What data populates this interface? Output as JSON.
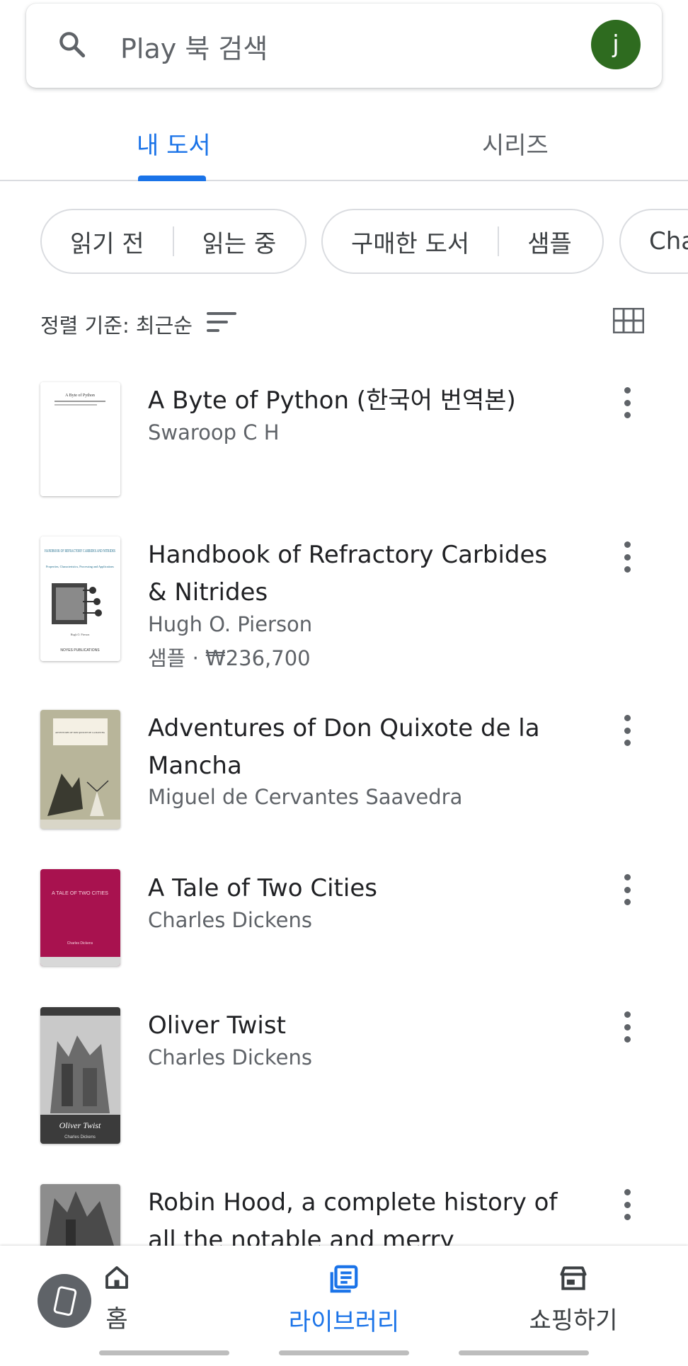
{
  "search": {
    "placeholder": "Play 북 검색",
    "avatar_letter": "j"
  },
  "tabs": [
    {
      "label": "내 도서",
      "active": true
    },
    {
      "label": "시리즈",
      "active": false
    }
  ],
  "filters": {
    "chip1": [
      "읽기 전",
      "읽는 중"
    ],
    "chip2": [
      "구매한 도서",
      "샘플"
    ],
    "chip3": [
      "Cha"
    ]
  },
  "sort": {
    "label": "정렬 기준: 최근순"
  },
  "books": [
    {
      "title": "A Byte of Python (한국어 번역본)",
      "author": "Swaroop C H",
      "meta": ""
    },
    {
      "title": "Handbook of Refractory Carbides & Nitrides",
      "author": "Hugh O. Pierson",
      "meta": "샘플 · ₩236,700"
    },
    {
      "title": "Adventures of Don Quixote de la Mancha",
      "author": "Miguel de Cervantes Saavedra",
      "meta": ""
    },
    {
      "title": "A Tale of Two Cities",
      "author": "Charles Dickens",
      "meta": ""
    },
    {
      "title": "Oliver Twist",
      "author": "Charles Dickens",
      "meta": ""
    },
    {
      "title": "Robin Hood, a complete history of all the notable and merry exploits...",
      "author": "",
      "meta": ""
    }
  ],
  "covers": {
    "byte_title": "A Byte of Python",
    "carbides_title": "HANDBOOK OF REFRACTORY CARBIDES AND NITRIDES",
    "carbides_subtitle": "Properties, Characteristics, Processing and Applications",
    "carbides_author": "Hugh O. Pierson",
    "carbides_publisher": "NOYES PUBLICATIONS",
    "quixote_title": "ADVENTURES OF DON QUIXOTE DE LA MANCHA",
    "tale_title": "A TALE OF TWO CITIES",
    "tale_author": "Charles Dickens",
    "oliver_title": "Oliver Twist",
    "oliver_author": "Charles Dickens"
  },
  "nav": {
    "home": "홈",
    "library": "라이브러리",
    "shop": "쇼핑하기"
  },
  "colors": {
    "accent": "#1a73e8",
    "avatar": "#2e6b1f",
    "tale_cover": "#a8124f"
  }
}
